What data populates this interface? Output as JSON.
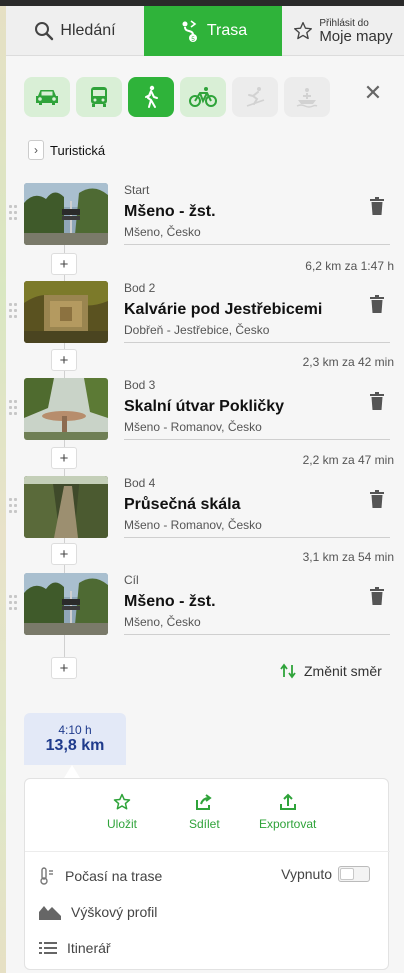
{
  "tabs": {
    "search_label": "Hledání",
    "route_label": "Trasa",
    "login_small": "Přihlásit do",
    "login_big": "Moje mapy"
  },
  "modes": [
    "car-icon",
    "bus-icon",
    "hiking-icon",
    "bicycle-icon",
    "skiing-icon",
    "boat-icon"
  ],
  "route_type": "Turistická",
  "waypoints": [
    {
      "label": "Start",
      "name": "Mšeno - žst.",
      "location": "Mšeno, Česko"
    },
    {
      "label": "Bod 2",
      "name": "Kalvárie pod Jestřebicemi",
      "location": "Dobřeň - Jestřebice, Česko"
    },
    {
      "label": "Bod 3",
      "name": "Skalní útvar Pokličky",
      "location": "Mšeno - Romanov, Česko"
    },
    {
      "label": "Bod 4",
      "name": "Průsečná skála",
      "location": "Mšeno - Romanov, Česko"
    },
    {
      "label": "Cíl",
      "name": "Mšeno - žst.",
      "location": "Mšeno, Česko"
    }
  ],
  "segments": [
    "6,2 km za 1:47 h",
    "2,3 km za 42 min",
    "2,2 km za 47 min",
    "3,1 km za 54 min"
  ],
  "reverse_label": "Změnit směr",
  "summary": {
    "time": "4:10 h",
    "distance": "13,8 km"
  },
  "actions": {
    "save": "Uložit",
    "share": "Sdílet",
    "export": "Exportovat"
  },
  "options": {
    "weather": "Počasí na trase",
    "weather_toggle": "Vypnuto",
    "elevation": "Výškový profil",
    "itinerary": "Itinerář"
  },
  "colors": {
    "accent": "#2fb33a",
    "summary_bg": "#e3e9f7",
    "summary_text": "#1f3b8c"
  }
}
